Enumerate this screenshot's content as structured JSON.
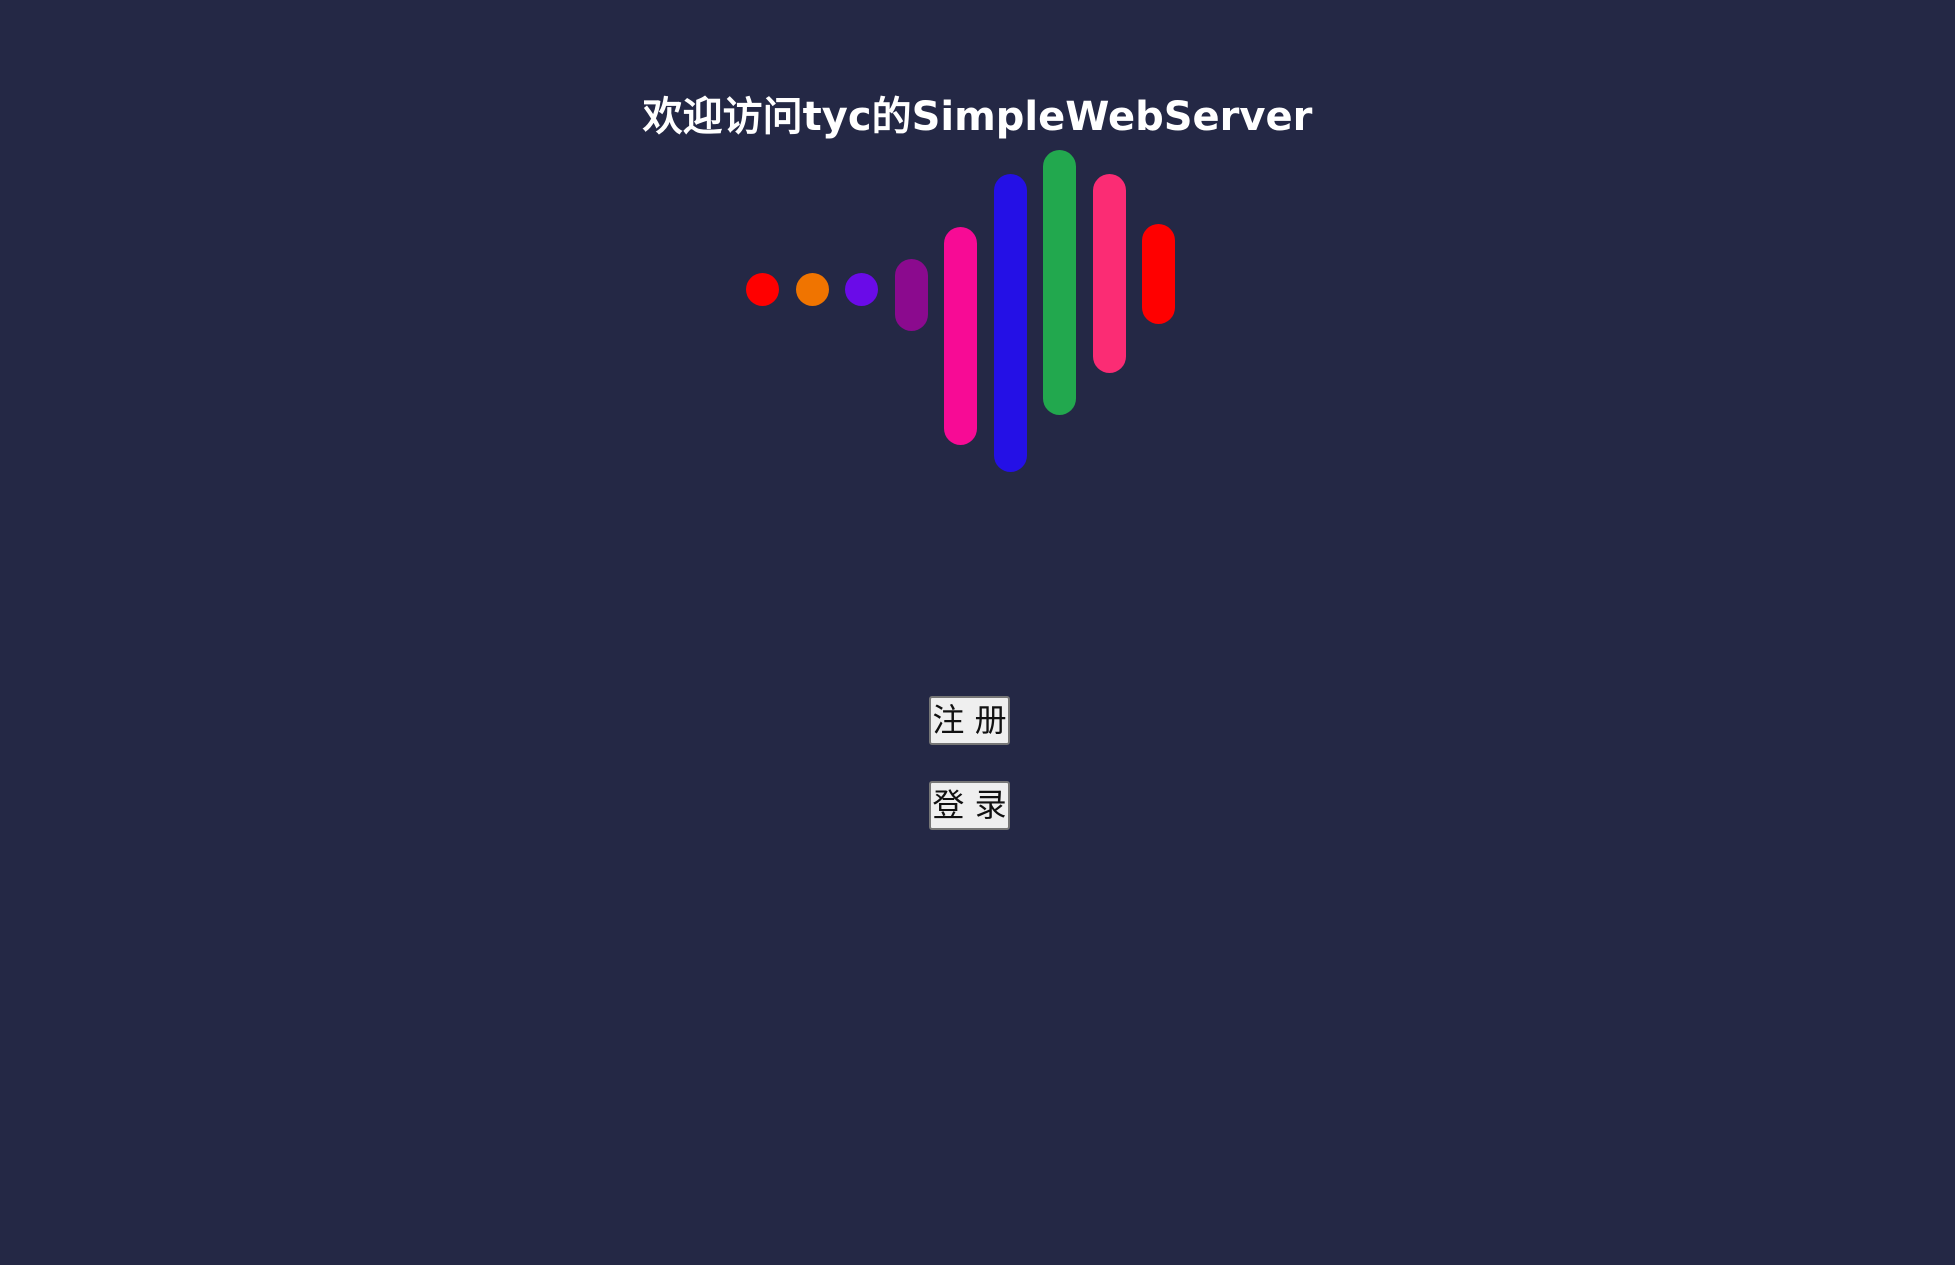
{
  "page": {
    "title": "欢迎访问tyc的SimpleWebServer"
  },
  "loader": {
    "icon": "equalizer-bars-animation",
    "bar_colors": [
      "#ff0000",
      "#f07400",
      "#6a0be8",
      "#8b0a8e",
      "#f70b95",
      "#2410e6",
      "#22a84e",
      "#fb2c74",
      "#ff0000"
    ]
  },
  "actions": {
    "register_label": "注 册",
    "login_label": "登 录"
  },
  "theme": {
    "background": "#242845",
    "title_color": "#ffffff"
  }
}
